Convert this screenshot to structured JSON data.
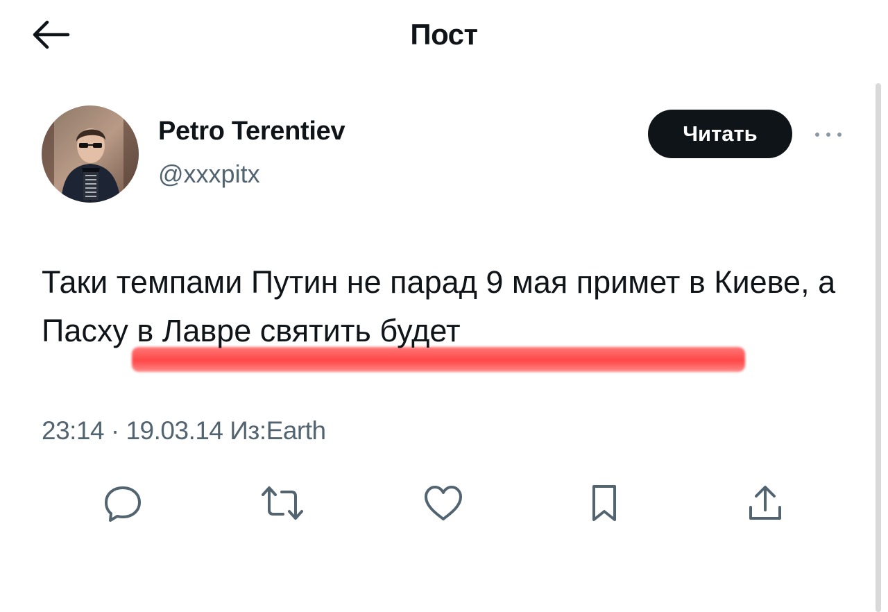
{
  "header": {
    "title": "Пост",
    "back_icon": "arrow-left-icon"
  },
  "author": {
    "name": "Petro Terentiev",
    "handle": "@xxxpitx",
    "follow_label": "Читать",
    "more_icon": "more-dots-icon"
  },
  "post": {
    "text": "Таки темпами Путин не парад 9 мая примет в Киеве, а Пасху в Лавре святить будет",
    "highlight_color": "#ff4d4d"
  },
  "meta": {
    "time": "23:14",
    "separator": "·",
    "date": "19.03.14",
    "source_prefix": "Из:",
    "source": "Earth"
  },
  "actions": [
    {
      "icon": "reply-icon"
    },
    {
      "icon": "repost-icon"
    },
    {
      "icon": "like-icon"
    },
    {
      "icon": "bookmark-icon"
    },
    {
      "icon": "share-icon"
    }
  ]
}
